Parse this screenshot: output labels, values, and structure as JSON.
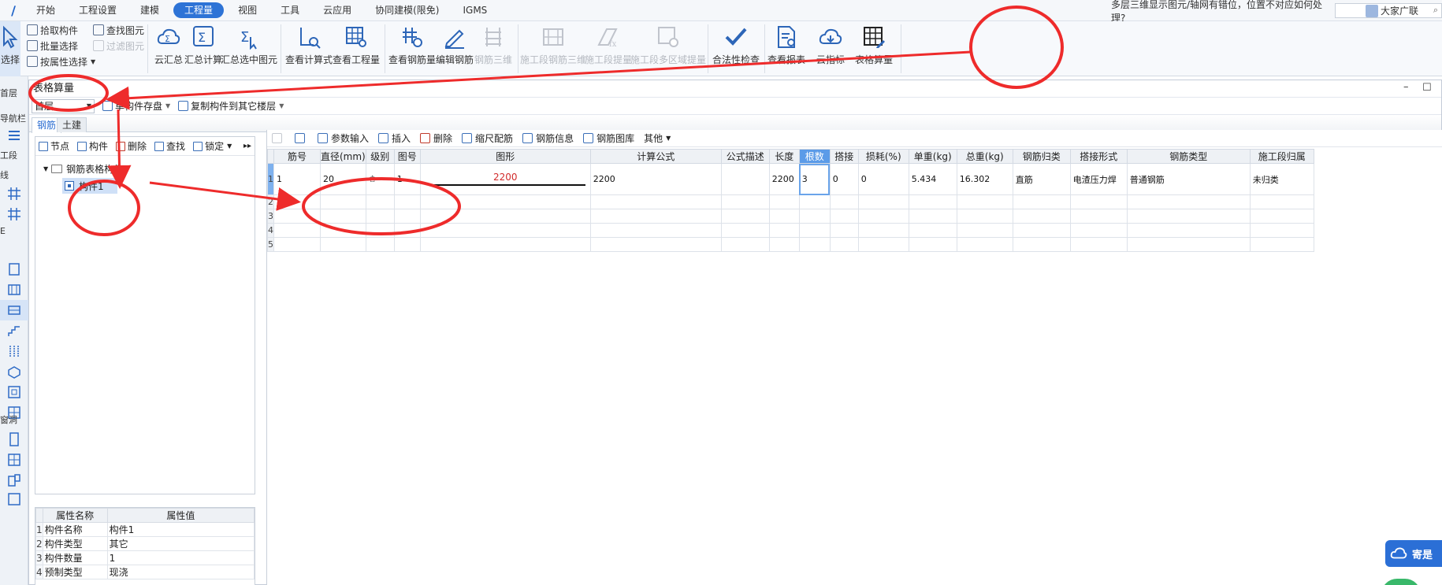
{
  "menu": {
    "items": [
      "开始",
      "工程设置",
      "建模",
      "工程量",
      "视图",
      "工具",
      "云应用",
      "协同建模(限免)",
      "IGMS"
    ],
    "active_index": 3,
    "help_text": "多层三维显示图元/轴网有错位，位置不对应如何处理?",
    "user_text": "大家广联"
  },
  "ribbon": {
    "select_label": "选择",
    "pick_component": "拾取构件",
    "batch_select": "批量选择",
    "by_attr_select": "按属性选择",
    "find_element": "查找图元",
    "filter_element": "过滤图元",
    "buttons": [
      {
        "label": "云汇总",
        "disabled": false,
        "icon": "cloud-sum-icon"
      },
      {
        "label": "汇总计算",
        "disabled": false,
        "icon": "sigma-icon"
      },
      {
        "label": "汇总选中图元",
        "disabled": false,
        "icon": "sigma-select-icon"
      },
      {
        "label": "查看计算式",
        "disabled": false,
        "icon": "view-formula-icon"
      },
      {
        "label": "查看工程量",
        "disabled": false,
        "icon": "view-quantity-icon"
      },
      {
        "label": "查看钢筋量",
        "disabled": false,
        "icon": "view-rebar-icon"
      },
      {
        "label": "编辑钢筋",
        "disabled": false,
        "icon": "edit-rebar-icon"
      },
      {
        "label": "钢筋三维",
        "disabled": true,
        "icon": "rebar-3d-icon"
      },
      {
        "label": "施工段钢筋三维",
        "disabled": true,
        "icon": "section-rebar-3d-icon"
      },
      {
        "label": "施工段提量",
        "disabled": true,
        "icon": "section-quantity-icon"
      },
      {
        "label": "施工段多区域提量",
        "disabled": true,
        "icon": "section-multi-icon"
      },
      {
        "label": "合法性检查",
        "disabled": false,
        "icon": "check-icon"
      },
      {
        "label": "查看报表",
        "disabled": false,
        "icon": "report-icon"
      },
      {
        "label": "云指标",
        "disabled": false,
        "icon": "cloud-index-icon"
      },
      {
        "label": "表格算量",
        "disabled": false,
        "icon": "table-calc-icon"
      }
    ]
  },
  "left_strip": {
    "labels": [
      "首层",
      "导航栏",
      "工段",
      "线",
      "E",
      "窗洞"
    ]
  },
  "dialog": {
    "title": "表格算量",
    "floor": "首层",
    "save_single": "单构件存盘",
    "copy_to_floor": "复制构件到其它楼层",
    "tabs": [
      "钢筋",
      "土建"
    ],
    "active_tab": 0
  },
  "tree": {
    "toolbar": [
      "节点",
      "构件",
      "删除",
      "查找",
      "锁定"
    ],
    "root": "钢筋表格构件",
    "child": "构件1"
  },
  "props": {
    "headers": [
      "属性名称",
      "属性值"
    ],
    "rows": [
      {
        "n": "1",
        "name": "构件名称",
        "value": "构件1"
      },
      {
        "n": "2",
        "name": "构件类型",
        "value": "其它"
      },
      {
        "n": "3",
        "name": "构件数量",
        "value": "1"
      },
      {
        "n": "4",
        "name": "预制类型",
        "value": "现浇"
      }
    ]
  },
  "grid_toolbar": {
    "items": [
      "参数输入",
      "插入",
      "删除",
      "缩尺配筋",
      "钢筋信息",
      "钢筋图库",
      "其他"
    ]
  },
  "grid": {
    "headers": [
      "筋号",
      "直径(mm)",
      "级别",
      "图号",
      "图形",
      "计算公式",
      "公式描述",
      "长度",
      "根数",
      "搭接",
      "损耗(%)",
      "单重(kg)",
      "总重(kg)",
      "钢筋归类",
      "搭接形式",
      "钢筋类型",
      "施工段归属"
    ],
    "row1": {
      "bar_no": "1",
      "diameter": "20",
      "grade": "♔",
      "fig_no": "1",
      "shape_value": "2200",
      "formula": "2200",
      "formula_desc": "",
      "length": "2200",
      "count": "3",
      "lap": "0",
      "loss": "0",
      "unit_weight": "5.434",
      "total_weight": "16.302",
      "category": "直筋",
      "lap_type": "电渣压力焊",
      "rebar_type": "普通钢筋",
      "section": "未归类"
    },
    "row_numbers": [
      "1",
      "2",
      "3",
      "4",
      "5"
    ]
  },
  "float_widget": {
    "label": "寄是"
  },
  "colors": {
    "accent": "#2d73d6",
    "annotation": "#ee2b2b",
    "shape_text": "#d12b2b"
  }
}
